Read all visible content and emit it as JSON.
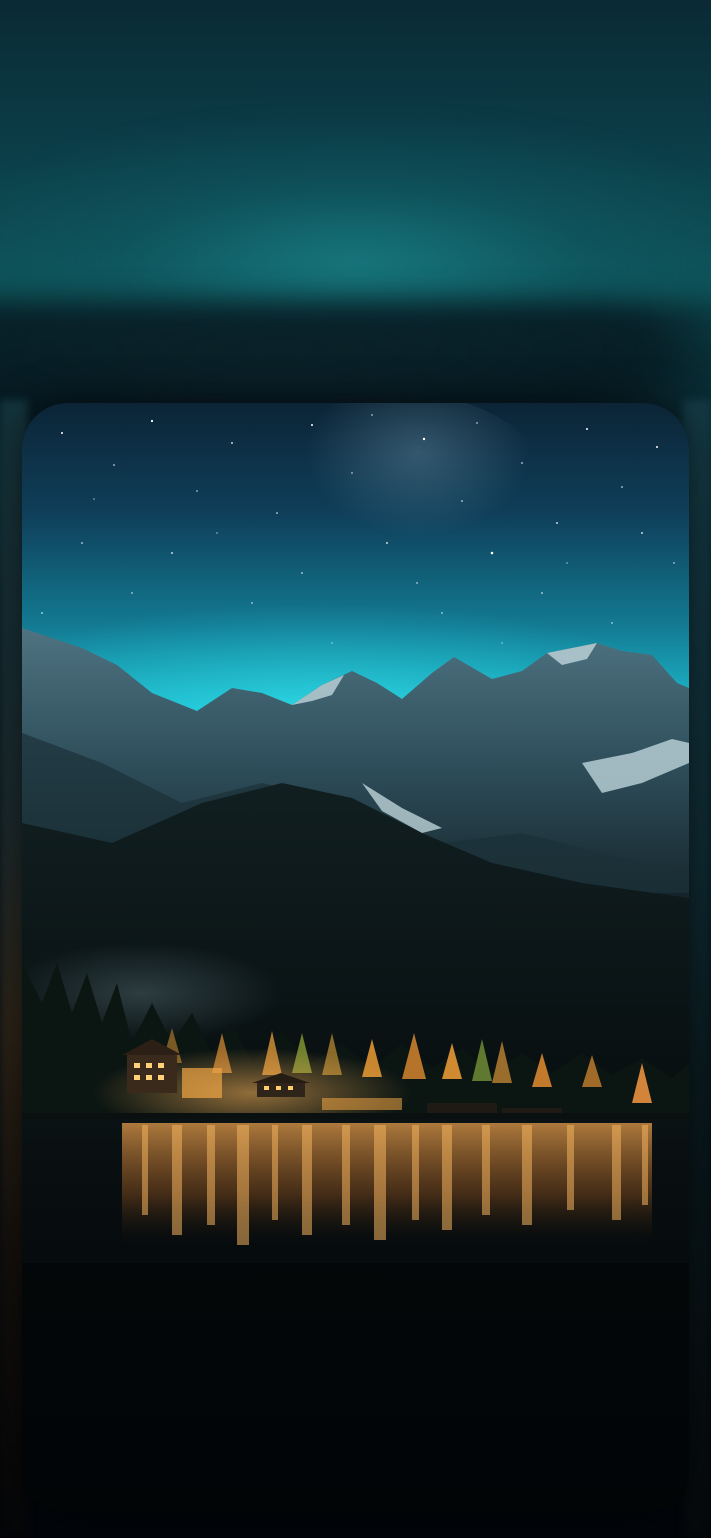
{
  "screen": {
    "type": "wallpaper-preview",
    "scene": "night-mountain-lake",
    "palette": {
      "sky_top": "#0c2a3f",
      "sky_glow": "#1fc4d6",
      "mountain": "#3f6270",
      "snow": "#c8dde3",
      "forest": "#0d1b1c",
      "village_light": "#f0a545",
      "water_reflection": "#d2843a",
      "deep_water": "#03080b"
    }
  }
}
